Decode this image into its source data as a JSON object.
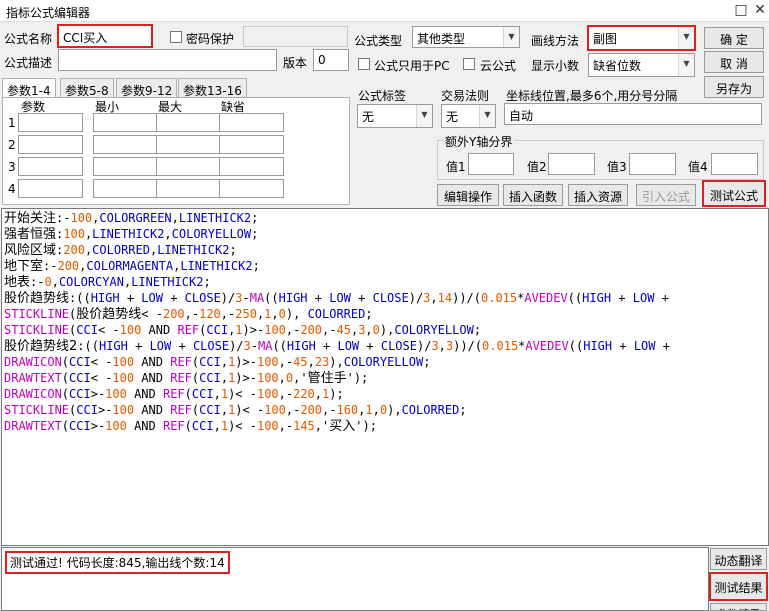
{
  "window": {
    "title": "指标公式编辑器",
    "minimize": "□",
    "close": "✕"
  },
  "form": {
    "name_label": "公式名称",
    "name_value": "CCI买入",
    "password_label": "密码保护",
    "desc_label": "公式描述",
    "version_label": "版本",
    "version_value": "0",
    "type_label": "公式类型",
    "type_value": "其他类型",
    "draw_label": "画线方法",
    "draw_value": "副图",
    "pc_only_label": "公式只用于PC",
    "cloud_label": "云公式",
    "decimals_label": "显示小数",
    "decimals_value": "缺省位数"
  },
  "buttons": {
    "ok": "确 定",
    "cancel": "取 消",
    "save_as": "另存为",
    "edit_ops": "编辑操作",
    "insert_func": "插入函数",
    "insert_res": "插入资源",
    "import_formula": "引入公式",
    "test_formula": "测试公式",
    "dyn_translate": "动态翻译",
    "test_result": "测试结果",
    "param_tip": "参数精灵"
  },
  "tabs": [
    "参数1-4",
    "参数5-8",
    "参数9-12",
    "参数13-16"
  ],
  "param_table": {
    "headers": [
      "参数",
      "最小",
      "最大",
      "缺省"
    ],
    "rows": [
      "1",
      "2",
      "3",
      "4"
    ]
  },
  "indicator": {
    "label_label": "公式标签",
    "label_value": "无",
    "trade_label": "交易法则",
    "trade_value": "无",
    "axis_label": "坐标线位置,最多6个,用分号分隔",
    "axis_value": "自动"
  },
  "yaxis": {
    "title": "额外Y轴分界",
    "labels": [
      "值1",
      "值2",
      "值3",
      "值4"
    ]
  },
  "code_lines": [
    [
      [
        "开始关注",
        1
      ],
      [
        ":-",
        0
      ],
      [
        "100",
        2
      ],
      [
        ",",
        0
      ],
      [
        "COLORGREEN",
        3
      ],
      [
        ",",
        0
      ],
      [
        "LINETHICK2",
        3
      ],
      [
        ";",
        0
      ]
    ],
    [
      [
        "强者恒强",
        1
      ],
      [
        ":",
        0
      ],
      [
        "100",
        2
      ],
      [
        ",",
        0
      ],
      [
        "LINETHICK2",
        3
      ],
      [
        ",",
        0
      ],
      [
        "COLORYELLOW",
        3
      ],
      [
        ";",
        0
      ]
    ],
    [
      [
        "风险区域",
        1
      ],
      [
        ":",
        0
      ],
      [
        "200",
        2
      ],
      [
        ",",
        0
      ],
      [
        "COLORRED",
        3
      ],
      [
        ",",
        0
      ],
      [
        "LINETHICK2",
        3
      ],
      [
        ";",
        0
      ]
    ],
    [
      [
        "地下室",
        1
      ],
      [
        ":-",
        0
      ],
      [
        "200",
        2
      ],
      [
        ",",
        0
      ],
      [
        "COLORMAGENTA",
        3
      ],
      [
        ",",
        0
      ],
      [
        "LINETHICK2",
        3
      ],
      [
        ";",
        0
      ]
    ],
    [
      [
        "地表",
        1
      ],
      [
        ":-",
        0
      ],
      [
        "0",
        2
      ],
      [
        ",",
        0
      ],
      [
        "COLORCYAN",
        3
      ],
      [
        ",",
        0
      ],
      [
        "LINETHICK2",
        3
      ],
      [
        ";",
        0
      ]
    ],
    [
      [
        "股价趋势线",
        1
      ],
      [
        ":((",
        0
      ],
      [
        "HIGH",
        3
      ],
      [
        " + ",
        0
      ],
      [
        "LOW",
        3
      ],
      [
        " + ",
        0
      ],
      [
        "CLOSE",
        3
      ],
      [
        ")/",
        0
      ],
      [
        "3",
        2
      ],
      [
        "-",
        0
      ],
      [
        "MA",
        4
      ],
      [
        "((",
        0
      ],
      [
        "HIGH",
        3
      ],
      [
        " + ",
        0
      ],
      [
        "LOW",
        3
      ],
      [
        " + ",
        0
      ],
      [
        "CLOSE",
        3
      ],
      [
        ")/",
        0
      ],
      [
        "3",
        2
      ],
      [
        ",",
        0
      ],
      [
        "14",
        2
      ],
      [
        "))/(",
        0
      ],
      [
        "0.015",
        2
      ],
      [
        "*",
        0
      ],
      [
        "AVEDEV",
        4
      ],
      [
        "((",
        0
      ],
      [
        "HIGH",
        3
      ],
      [
        " + ",
        0
      ],
      [
        "LOW",
        3
      ],
      [
        " +",
        0
      ]
    ],
    [
      [
        "STICKLINE",
        4
      ],
      [
        "(",
        0
      ],
      [
        "股价趋势线",
        1
      ],
      [
        "< -",
        0
      ],
      [
        "200",
        2
      ],
      [
        ",-",
        0
      ],
      [
        "120",
        2
      ],
      [
        ",-",
        0
      ],
      [
        "250",
        2
      ],
      [
        ",",
        0
      ],
      [
        "1",
        2
      ],
      [
        ",",
        0
      ],
      [
        "0",
        2
      ],
      [
        "), ",
        0
      ],
      [
        "COLORRED",
        3
      ],
      [
        ";",
        0
      ]
    ],
    [
      [
        "STICKLINE",
        4
      ],
      [
        "(",
        0
      ],
      [
        "CCI",
        3
      ],
      [
        "< -",
        0
      ],
      [
        "100",
        2
      ],
      [
        " AND ",
        0
      ],
      [
        "REF",
        4
      ],
      [
        "(",
        0
      ],
      [
        "CCI",
        3
      ],
      [
        ",",
        0
      ],
      [
        "1",
        2
      ],
      [
        ")>-",
        0
      ],
      [
        "100",
        2
      ],
      [
        ",-",
        0
      ],
      [
        "200",
        2
      ],
      [
        ",-",
        0
      ],
      [
        "45",
        2
      ],
      [
        ",",
        0
      ],
      [
        "3",
        2
      ],
      [
        ",",
        0
      ],
      [
        "0",
        2
      ],
      [
        "),",
        0
      ],
      [
        "COLORYELLOW",
        3
      ],
      [
        ";",
        0
      ]
    ],
    [
      [
        "股价趋势线2",
        1
      ],
      [
        ":((",
        0
      ],
      [
        "HIGH",
        3
      ],
      [
        " + ",
        0
      ],
      [
        "LOW",
        3
      ],
      [
        " + ",
        0
      ],
      [
        "CLOSE",
        3
      ],
      [
        ")/",
        0
      ],
      [
        "3",
        2
      ],
      [
        "-",
        0
      ],
      [
        "MA",
        4
      ],
      [
        "((",
        0
      ],
      [
        "HIGH",
        3
      ],
      [
        " + ",
        0
      ],
      [
        "LOW",
        3
      ],
      [
        " + ",
        0
      ],
      [
        "CLOSE",
        3
      ],
      [
        ")/",
        0
      ],
      [
        "3",
        2
      ],
      [
        ",",
        0
      ],
      [
        "3",
        2
      ],
      [
        "))/(",
        0
      ],
      [
        "0.015",
        2
      ],
      [
        "*",
        0
      ],
      [
        "AVEDEV",
        4
      ],
      [
        "((",
        0
      ],
      [
        "HIGH",
        3
      ],
      [
        " + ",
        0
      ],
      [
        "LOW",
        3
      ],
      [
        " +",
        0
      ]
    ],
    [
      [
        "DRAWICON",
        4
      ],
      [
        "(",
        0
      ],
      [
        "CCI",
        3
      ],
      [
        "< -",
        0
      ],
      [
        "100",
        2
      ],
      [
        " AND ",
        0
      ],
      [
        "REF",
        4
      ],
      [
        "(",
        0
      ],
      [
        "CCI",
        3
      ],
      [
        ",",
        0
      ],
      [
        "1",
        2
      ],
      [
        ")>-",
        0
      ],
      [
        "100",
        2
      ],
      [
        ",-",
        0
      ],
      [
        "45",
        2
      ],
      [
        ",",
        0
      ],
      [
        "23",
        2
      ],
      [
        "),",
        0
      ],
      [
        "COLORYELLOW",
        3
      ],
      [
        ";",
        0
      ]
    ],
    [
      [
        "DRAWTEXT",
        4
      ],
      [
        "(",
        0
      ],
      [
        "CCI",
        3
      ],
      [
        "< -",
        0
      ],
      [
        "100",
        2
      ],
      [
        " AND ",
        0
      ],
      [
        "REF",
        4
      ],
      [
        "(",
        0
      ],
      [
        "CCI",
        3
      ],
      [
        ",",
        0
      ],
      [
        "1",
        2
      ],
      [
        ")>-",
        0
      ],
      [
        "100",
        2
      ],
      [
        ",",
        0
      ],
      [
        "0",
        2
      ],
      [
        ",'",
        0
      ],
      [
        "管住手",
        1
      ],
      [
        "');",
        0
      ]
    ],
    [
      [
        "DRAWICON",
        4
      ],
      [
        "(",
        0
      ],
      [
        "CCI",
        3
      ],
      [
        ">-",
        0
      ],
      [
        "100",
        2
      ],
      [
        " AND ",
        0
      ],
      [
        "REF",
        4
      ],
      [
        "(",
        0
      ],
      [
        "CCI",
        3
      ],
      [
        ",",
        0
      ],
      [
        "1",
        2
      ],
      [
        ")< -",
        0
      ],
      [
        "100",
        2
      ],
      [
        ",-",
        0
      ],
      [
        "220",
        2
      ],
      [
        ",",
        0
      ],
      [
        "1",
        2
      ],
      [
        ");",
        0
      ]
    ],
    [
      [
        "STICKLINE",
        4
      ],
      [
        "(",
        0
      ],
      [
        "CCI",
        3
      ],
      [
        ">-",
        0
      ],
      [
        "100",
        2
      ],
      [
        " AND ",
        0
      ],
      [
        "REF",
        4
      ],
      [
        "(",
        0
      ],
      [
        "CCI",
        3
      ],
      [
        ",",
        0
      ],
      [
        "1",
        2
      ],
      [
        ")< -",
        0
      ],
      [
        "100",
        2
      ],
      [
        ",-",
        0
      ],
      [
        "200",
        2
      ],
      [
        ",-",
        0
      ],
      [
        "160",
        2
      ],
      [
        ",",
        0
      ],
      [
        "1",
        2
      ],
      [
        ",",
        0
      ],
      [
        "0",
        2
      ],
      [
        "),",
        0
      ],
      [
        "COLORRED",
        3
      ],
      [
        ";",
        0
      ]
    ],
    [
      [
        "DRAWTEXT",
        4
      ],
      [
        "(",
        0
      ],
      [
        "CCI",
        3
      ],
      [
        ">-",
        0
      ],
      [
        "100",
        2
      ],
      [
        " AND ",
        0
      ],
      [
        "REF",
        4
      ],
      [
        "(",
        0
      ],
      [
        "CCI",
        3
      ],
      [
        ",",
        0
      ],
      [
        "1",
        2
      ],
      [
        ")< -",
        0
      ],
      [
        "100",
        2
      ],
      [
        ",-",
        0
      ],
      [
        "145",
        2
      ],
      [
        ",'",
        0
      ],
      [
        "买入",
        1
      ],
      [
        "');",
        0
      ]
    ]
  ],
  "code_colors": [
    "#000000",
    "#000000",
    "#e05a00",
    "#0000c0",
    "#c000c0"
  ],
  "status": {
    "message": "测试通过! 代码长度:845,输出线个数:14"
  },
  "highlight_color": "#e02020"
}
